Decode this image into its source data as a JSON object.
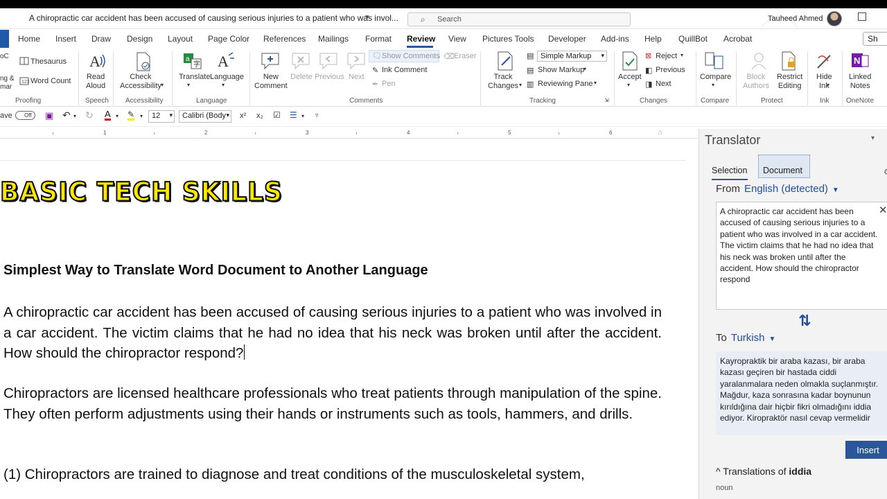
{
  "window": {
    "title": "A chiropractic car accident has been accused of causing serious injuries to a patient who was invol...",
    "search_placeholder": "Search",
    "user_name": "Tauheed Ahmed"
  },
  "menu": {
    "tabs": [
      "Home",
      "Insert",
      "Draw",
      "Design",
      "Layout",
      "Page Color",
      "References",
      "Mailings",
      "Format",
      "Review",
      "View",
      "Pictures Tools",
      "Developer",
      "Add-ins",
      "Help",
      "QuillBot",
      "Acrobat"
    ],
    "active": "Review",
    "share": "Sh"
  },
  "ribbon": {
    "proofing": {
      "top_partial": "oC",
      "spelling_partial": "ng &\nmar",
      "thesaurus": "Thesaurus",
      "word_count": "Word Count",
      "label": "Proofing"
    },
    "speech": {
      "read_aloud": "Read\nAloud",
      "label": "Speech"
    },
    "accessibility": {
      "check": "Check\nAccessibility",
      "label": "Accessibility"
    },
    "language": {
      "translate": "Translate",
      "language": "Language",
      "label": "Language"
    },
    "comments": {
      "new": "New\nComment",
      "delete": "Delete",
      "previous": "Previous",
      "next": "Next",
      "show_comments": "Show Comments",
      "ink_comment": "Ink Comment",
      "pen": "Pen",
      "eraser": "Eraser",
      "label": "Comments"
    },
    "tracking": {
      "track_changes": "Track\nChanges",
      "markup_mode": "Simple Markup",
      "show_markup": "Show Markup",
      "reviewing_pane": "Reviewing Pane",
      "label": "Tracking"
    },
    "changes": {
      "accept": "Accept",
      "reject": "Reject",
      "previous": "Previous",
      "next": "Next",
      "label": "Changes"
    },
    "compare": {
      "compare": "Compare",
      "label": "Compare"
    },
    "protect": {
      "block_authors": "Block\nAuthors",
      "restrict_editing": "Restrict\nEditing",
      "label": "Protect"
    },
    "ink": {
      "hide_ink": "Hide\nInk",
      "label": "Ink"
    },
    "onenote": {
      "linked_notes": "Linked\nNotes",
      "label": "OneNote"
    }
  },
  "quick_toolbar": {
    "autosave_label": "ave",
    "autosave_state": "Off",
    "font_size": "12",
    "font_name": "Calibri (Body"
  },
  "ruler": {
    "numbers": [
      "1",
      "2",
      "3",
      "4",
      "5",
      "6"
    ]
  },
  "document": {
    "logo_text": "BASIC TECH SKILLS",
    "heading": "Simplest Way to Translate Word Document to Another Language",
    "paragraph1": "A chiropractic car accident has been accused of causing serious injuries to a patient who was involved in a car accident. The victim claims that he had no idea that his neck was broken until after the accident. How should the chiropractor respond?",
    "paragraph2": "Chiropractors are licensed healthcare professionals who treat patients through manipulation of the spine. They often perform adjustments using their hands or instruments such as tools, hammers, and drills.",
    "paragraph3": "(1) Chiropractors are trained to diagnose and treat conditions of the musculoskeletal system,"
  },
  "translator": {
    "title": "Translator",
    "tabs": {
      "selection": "Selection",
      "document": "Document"
    },
    "from_label": "From",
    "from_lang": "English (detected)",
    "source_text": "A chiropractic car accident has been accused of causing serious injuries to a patient who was involved in a car accident. The victim claims that he had no idea that his neck was broken until after the accident. How should the chiropractor respond",
    "to_label": "To",
    "to_lang": "Turkish",
    "target_text": "Kayropraktik bir araba kazası, bir araba kazası geçiren bir hastada ciddi yaralanmalara neden olmakla suçlanmıştır. Mağdur, kaza sonrasına kadar boynunun kırıldığına dair hiçbir fikri olmadığını iddia ediyor. Kiropraktör nasıl cevap vermelidir",
    "insert_button": "Insert",
    "translations_of_prefix": "Translations of",
    "translations_of_word": "iddia",
    "noun_label": "noun"
  },
  "colors": {
    "accent": "#2b579a",
    "logo_yellow": "#ffe800",
    "pane_bg": "#f3f3f3",
    "target_bg": "#e9eef6"
  }
}
